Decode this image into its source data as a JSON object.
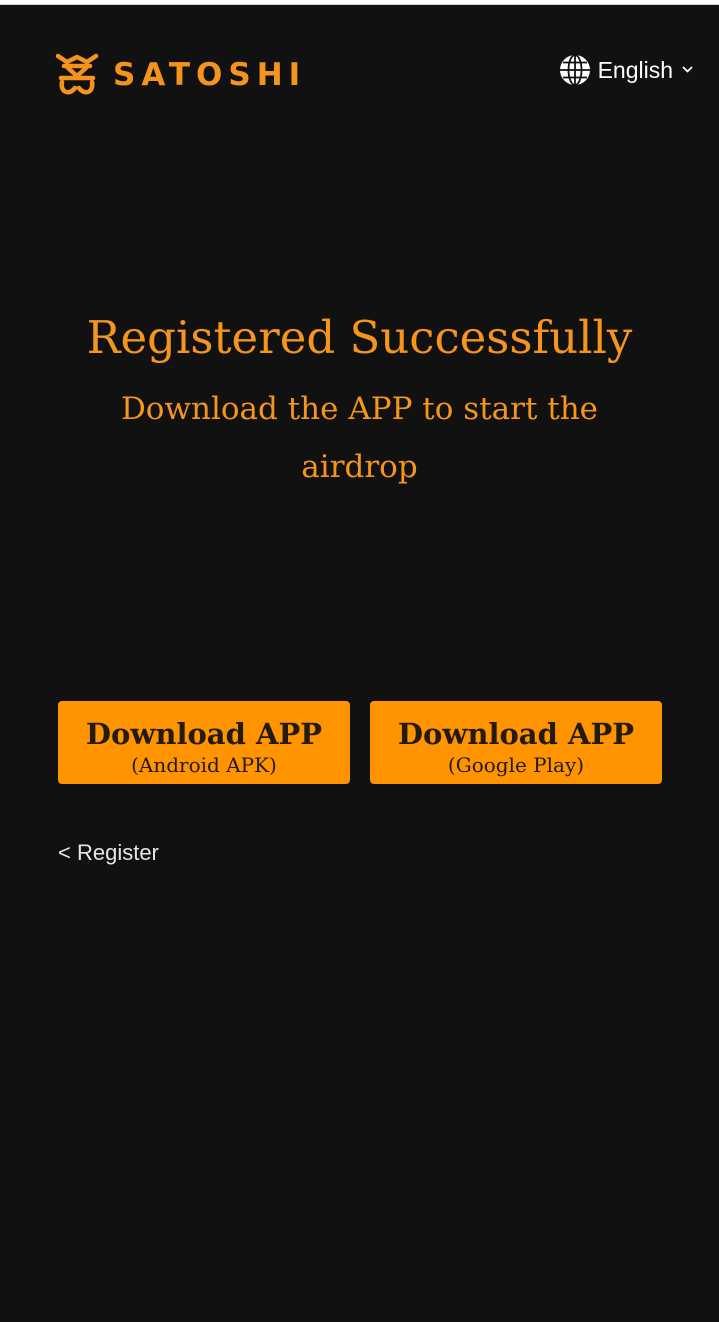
{
  "brand": {
    "name": "SATOSHI",
    "color": "#f5941d"
  },
  "language": {
    "selected": "English"
  },
  "main": {
    "heading": "Registered Successfully",
    "subheading": "Download the APP to start the airdrop"
  },
  "buttons": [
    {
      "title": "Download APP",
      "subtitle": "(Android APK)"
    },
    {
      "title": "Download APP",
      "subtitle": "(Google Play)"
    }
  ],
  "nav": {
    "back_label": "< Register"
  },
  "colors": {
    "background": "#111111",
    "accent": "#ff9400",
    "heading_text": "#f3951e",
    "button_text": "#231a10"
  }
}
